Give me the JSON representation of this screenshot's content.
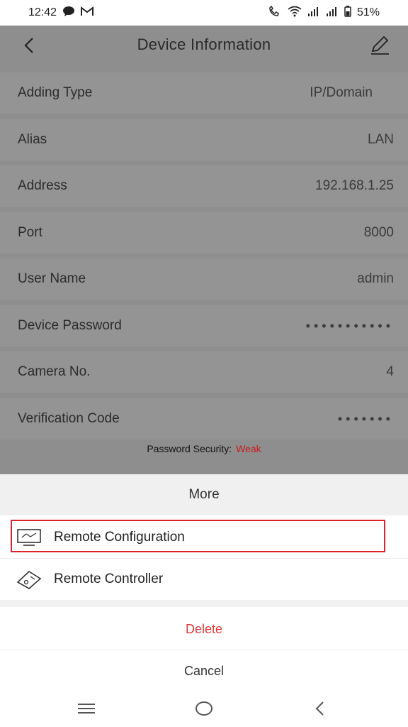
{
  "status": {
    "time": "12:42",
    "battery": "51%",
    "icons": [
      "chat-icon",
      "gmail-icon",
      "call-icon",
      "wifi-icon",
      "signal-icon",
      "signal-icon",
      "battery-icon"
    ]
  },
  "nav": {
    "title": "Device Information"
  },
  "rows": [
    {
      "label": "Adding Type",
      "value": "IP/Domain"
    },
    {
      "label": "Alias",
      "value": "LAN"
    },
    {
      "label": "Address",
      "value": "192.168.1.25"
    },
    {
      "label": "Port",
      "value": "8000"
    },
    {
      "label": "User Name",
      "value": "admin"
    },
    {
      "label": "Device Password",
      "value": "•••••••••••"
    },
    {
      "label": "Camera No.",
      "value": "4"
    },
    {
      "label": "Verification Code",
      "value": "•••••••"
    }
  ],
  "security": {
    "label": "Password Security:",
    "level": "Weak",
    "level_color": "#c81a1a"
  },
  "sheet": {
    "title": "More",
    "items": [
      {
        "label": "Remote Configuration",
        "icon": "monitor-icon"
      },
      {
        "label": "Remote Controller",
        "icon": "remote-control-icon"
      }
    ],
    "delete_label": "Delete",
    "cancel_label": "Cancel"
  },
  "colors": {
    "accent_red": "#e0393b",
    "highlight_border": "#d9232d",
    "dim_overlay": "#8e8e8e"
  }
}
